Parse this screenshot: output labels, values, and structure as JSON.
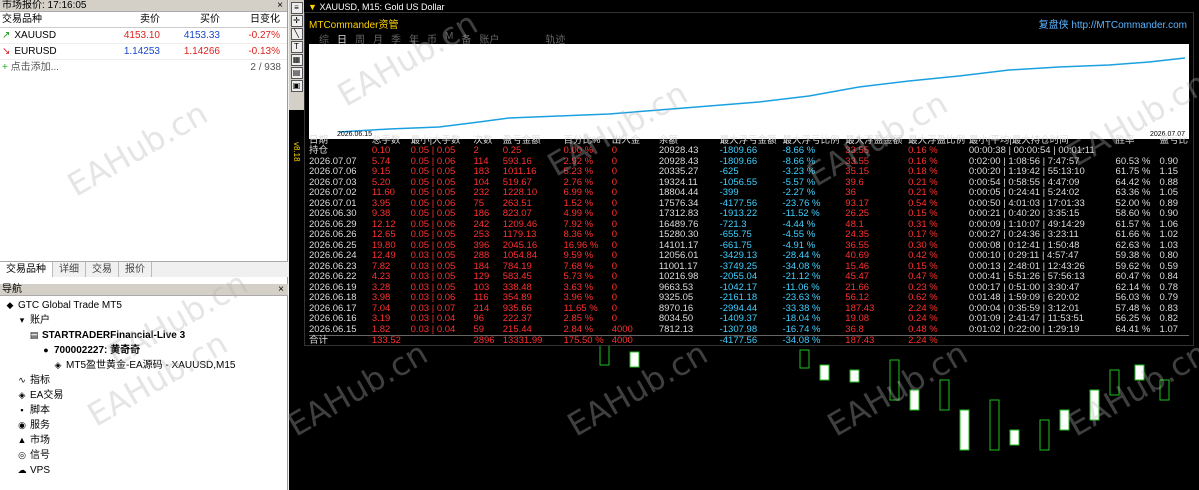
{
  "market_watch": {
    "title": "市场报价: 17:16:05",
    "headers": [
      "交易品种",
      "卖价",
      "买价",
      "日变化"
    ],
    "rows": [
      {
        "symbol": "XAUUSD",
        "bid": "4153.10",
        "ask": "4153.33",
        "change": "-0.27%",
        "dir": "up"
      },
      {
        "symbol": "EURUSD",
        "bid": "1.14253",
        "ask": "1.14266",
        "change": "-0.13%",
        "dir": "down"
      }
    ],
    "add_label": "点击添加...",
    "count": "2 / 938",
    "tabs": [
      "交易品种",
      "详细",
      "交易",
      "报价"
    ]
  },
  "navigator": {
    "title": "导航",
    "items": [
      {
        "label": "GTC Global Trade MT5",
        "lvl": 0,
        "icon": "◆"
      },
      {
        "label": "账户",
        "lvl": 1,
        "icon": "▾"
      },
      {
        "label": "STARTRADERFinancial-Live 3",
        "lvl": 2,
        "icon": "▤",
        "bold": true
      },
      {
        "label": "700002227: 黄奇奇",
        "lvl": 3,
        "icon": "●",
        "bold": true
      },
      {
        "label": "MT5盈世黄金-EA源码 - XAUUSD,M15",
        "lvl": 4,
        "icon": "◈"
      },
      {
        "label": "指标",
        "lvl": 1,
        "icon": "∿"
      },
      {
        "label": "EA交易",
        "lvl": 1,
        "icon": "◈"
      },
      {
        "label": "脚本",
        "lvl": 1,
        "icon": "▪"
      },
      {
        "label": "服务",
        "lvl": 1,
        "icon": "◉"
      },
      {
        "label": "市场",
        "lvl": 1,
        "icon": "▲"
      },
      {
        "label": "信号",
        "lvl": 1,
        "icon": "◎"
      },
      {
        "label": "VPS",
        "lvl": 1,
        "icon": "☁"
      }
    ]
  },
  "chart": {
    "title": "XAUUSD, M15:  Gold US Dollar"
  },
  "panel": {
    "title": "MTCommander资管",
    "link": "复盘侠 http://MTCommander.com",
    "tabs": [
      "综",
      "日",
      "周",
      "月",
      "季",
      "年",
      "币",
      "M",
      "备",
      "账户",
      "",
      "轨迹"
    ],
    "date_start": "2026.06.15",
    "date_end": "2026.07.07",
    "headers": [
      "日期",
      "总手数",
      "最小|大手数",
      "次数",
      "盈亏金额",
      "百分比%",
      "出入金",
      "余额",
      "最大浮亏金额",
      "最大浮亏比例",
      "最大浮盈金额",
      "最大浮盈比例",
      "最小|平均|最大持仓时间",
      "胜率",
      "盈亏比"
    ],
    "rows": [
      [
        "持仓",
        "0.10",
        "0.05 | 0.05",
        "2",
        "0.25",
        "0.00 %",
        "0",
        "20928.43",
        "-1809.66",
        "-8.66 %",
        "33.55",
        "0.16 %",
        "00:00:38 | 00:00:54 | 00:01:11",
        "",
        ""
      ],
      [
        "2026.07.07",
        "5.74",
        "0.05 | 0.06",
        "114",
        "593.16",
        "2.92 %",
        "0",
        "20928.43",
        "-1809.66",
        "-8.66 %",
        "33.55",
        "0.16 %",
        "0:02:00 | 1:08:56 | 7:47:57",
        "60.53 %",
        "0.90"
      ],
      [
        "2026.07.06",
        "9.15",
        "0.05 | 0.05",
        "183",
        "1011.16",
        "5.23 %",
        "0",
        "20335.27",
        "-625",
        "-3.23 %",
        "35.15",
        "0.18 %",
        "0:00:20 | 1:19:42 | 55:13:10",
        "61.75 %",
        "1.15"
      ],
      [
        "2026.07.03",
        "5.20",
        "0.05 | 0.05",
        "104",
        "519.67",
        "2.76 %",
        "0",
        "19324.11",
        "-1056.55",
        "-5.57 %",
        "39.6",
        "0.21 %",
        "0:00:54 | 0:58:55 | 4:47:09",
        "64.42 %",
        "0.88"
      ],
      [
        "2026.07.02",
        "11.60",
        "0.05 | 0.05",
        "232",
        "1228.10",
        "6.99 %",
        "0",
        "18804.44",
        "-399",
        "-2.27 %",
        "36",
        "0.21 %",
        "0:00:05 | 0:24:41 | 5:24:02",
        "63.36 %",
        "1.05"
      ],
      [
        "2026.07.01",
        "3.95",
        "0.05 | 0.06",
        "75",
        "263.51",
        "1.52 %",
        "0",
        "17576.34",
        "-4177.56",
        "-23.76 %",
        "93.17",
        "0.54 %",
        "0:00:50 | 4:01:03 | 17:01:33",
        "52.00 %",
        "0.89"
      ],
      [
        "2026.06.30",
        "9.38",
        "0.05 | 0.05",
        "186",
        "823.07",
        "4.99 %",
        "0",
        "17312.83",
        "-1913.22",
        "-11.52 %",
        "26.25",
        "0.15 %",
        "0:00:21 | 0:40:20 | 3:35:15",
        "58.60 %",
        "0.90"
      ],
      [
        "2026.06.29",
        "12.12",
        "0.05 | 0.06",
        "242",
        "1209.46",
        "7.92 %",
        "0",
        "16489.76",
        "-721.3",
        "-4.44 %",
        "48.1",
        "0.31 %",
        "0:00:09 | 1:10:07 | 49:14:29",
        "61.57 %",
        "1.06"
      ],
      [
        "2026.06.26",
        "12.65",
        "0.05 | 0.05",
        "253",
        "1179.13",
        "8.36 %",
        "0",
        "15280.30",
        "-655.75",
        "-4.55 %",
        "24.35",
        "0.17 %",
        "0:00:27 | 0:24:36 | 3:23:11",
        "61.66 %",
        "1.02"
      ],
      [
        "2026.06.25",
        "19.80",
        "0.05 | 0.05",
        "396",
        "2045.16",
        "16.96 %",
        "0",
        "14101.17",
        "-661.75",
        "-4.91 %",
        "36.55",
        "0.30 %",
        "0:00:08 | 0:12:41 | 1:50:48",
        "62.63 %",
        "1.03"
      ],
      [
        "2026.06.24",
        "12.49",
        "0.03 | 0.05",
        "288",
        "1054.84",
        "9.59 %",
        "0",
        "12056.01",
        "-3429.13",
        "-28.44 %",
        "40.69",
        "0.42 %",
        "0:00:10 | 0:29:11 | 4:57:47",
        "59.38 %",
        "0.80"
      ],
      [
        "2026.06.23",
        "7.82",
        "0.03 | 0.05",
        "184",
        "784.19",
        "7.68 %",
        "0",
        "11001.17",
        "-3749.25",
        "-34.08 %",
        "15.46",
        "0.15 %",
        "0:00:13 | 2:48:01 | 12:43:26",
        "59.62 %",
        "0.59"
      ],
      [
        "2026.06.22",
        "4.23",
        "0.03 | 0.05",
        "129",
        "583.45",
        "5.73 %",
        "0",
        "10216.98",
        "-2055.04",
        "-21.12 %",
        "45.47",
        "0.47 %",
        "0:00:41 | 5:51:26 | 57:56:13",
        "60.47 %",
        "0.84"
      ],
      [
        "2026.06.19",
        "3.28",
        "0.03 | 0.05",
        "103",
        "338.48",
        "3.63 %",
        "0",
        "9663.53",
        "-1042.17",
        "-11.06 %",
        "21.66",
        "0.23 %",
        "0:00:17 | 0:51:00 | 3:30:47",
        "62.14 %",
        "0.78"
      ],
      [
        "2026.06.18",
        "3.98",
        "0.03 | 0.06",
        "116",
        "354.89",
        "3.96 %",
        "0",
        "9325.05",
        "-2161.18",
        "-23.63 %",
        "56.12",
        "0.62 %",
        "0:01:48 | 1:59:09 | 6:20:02",
        "56.03 %",
        "0.79"
      ],
      [
        "2026.06.17",
        "7.04",
        "0.03 | 0.07",
        "214",
        "935.66",
        "11.65 %",
        "0",
        "8970.16",
        "-2994.44",
        "-33.38 %",
        "187.43",
        "2.24 %",
        "0:00:04 | 0:35:59 | 3:12:01",
        "57.48 %",
        "0.83"
      ],
      [
        "2026.06.16",
        "3.19",
        "0.03 | 0.04",
        "96",
        "222.37",
        "2.85 %",
        "0",
        "8034.50",
        "-1409.37",
        "-18.04 %",
        "19.08",
        "0.24 %",
        "0:01:09 | 2:41:47 | 11:53:51",
        "56.25 %",
        "0.82"
      ],
      [
        "2026.06.15",
        "1.82",
        "0.03 | 0.04",
        "59",
        "215.44",
        "2.84 %",
        "4000",
        "7812.13",
        "-1307.98",
        "-16.74 %",
        "36.8",
        "0.48 %",
        "0:01:02 | 0:22:00 | 1:29:19",
        "64.41 %",
        "1.07"
      ]
    ],
    "sum": [
      "合计",
      "133.52",
      "",
      "2896",
      "13331.99",
      "175.50 %",
      "4000",
      "",
      "-4177.56",
      "-34.08 %",
      "187.43",
      "2.24 %",
      "",
      "",
      ""
    ]
  },
  "side_label": "v8.18",
  "watermark": "EAHub.cn"
}
